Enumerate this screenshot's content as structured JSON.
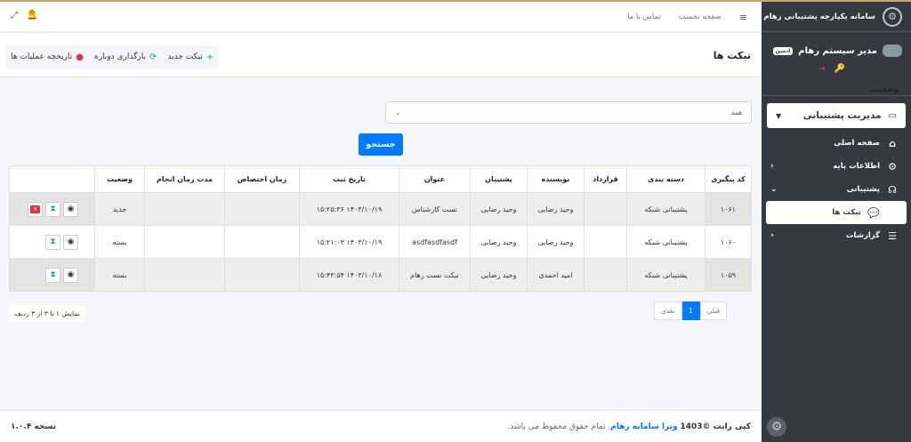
{
  "brand": {
    "title": "سامانه یکپارچه پشتیبانی رهام"
  },
  "user": {
    "name": "مدیر سیستم رهام",
    "badge": "ادمین"
  },
  "sidebar": {
    "section": "مدیریت پشتیبانی",
    "items": [
      {
        "label": "صفحه اصلی",
        "icon": "home-icon"
      },
      {
        "label": "اطلاعات پایه",
        "icon": "gears-icon"
      },
      {
        "label": "پشتیبانی",
        "icon": "headset-icon"
      },
      {
        "label": "تیکت ها",
        "icon": "comments-icon"
      },
      {
        "label": "گزارشات",
        "icon": "list-icon"
      }
    ]
  },
  "topnav": {
    "home": "صفحه نخست",
    "contact": "تماس با ما",
    "notif_count": "0"
  },
  "header": {
    "title": "تیکت ها",
    "new_ticket": "تیکت جدید",
    "reload": "بارگذاری دوباره",
    "history": "تاریخچه عملیات ها"
  },
  "filter": {
    "label": "وضعیت",
    "selected": "همه",
    "search": "جستجو"
  },
  "table": {
    "headers": [
      "کد پیگیری",
      "دسته بندی",
      "قرارداد",
      "نویسنده",
      "پشتیبان",
      "عنوان",
      "تاریخ ثبت",
      "زمان اختصاص",
      "مدت زمان انجام",
      "وضعیت",
      ""
    ],
    "rows": [
      {
        "code": "۱۰۶۱",
        "category": "پشتیبانی شبکه",
        "contract": "",
        "author": "وحید رضایی",
        "support": "وحید رضایی",
        "title": "تست کارشناس",
        "date": "۱۴۰۳/۱۰/۱۹ ۱۵:۲۵:۳۶",
        "assign": "",
        "duration": "",
        "status": "جدید"
      },
      {
        "code": "۱۰۶۰",
        "category": "پشتیبانی شبکه",
        "contract": "",
        "author": "وحید رضایی",
        "support": "وحید رضایی",
        "title": "asdfasdfasdf",
        "date": "۱۴۰۳/۱۰/۱۹ ۱۵:۲۱:۰۳",
        "assign": "",
        "duration": "",
        "status": "بسته"
      },
      {
        "code": "۱۰۵۹",
        "category": "پشتیبانی شبکه",
        "contract": "",
        "author": "امید احمدی",
        "support": "وحید رضایی",
        "title": "تیکت تست رهام",
        "date": "۱۴۰۳/۱۰/۱۸ ۱۵:۴۳:۵۴",
        "assign": "",
        "duration": "",
        "status": "بسته"
      }
    ]
  },
  "info": "نمایش ۱ تا ۳ از ۳ ردیف",
  "pager": {
    "prev": "قبلی",
    "page": "1",
    "next": "بعدی"
  },
  "footer": {
    "copy": "کپی رایت ©1403",
    "brand": "ویرا سامانه رهام",
    "rights": ". تمام حقوق محفوظ می باشد.",
    "version": "نسخه ۱.۰.۴"
  },
  "colors": {
    "primary": "#007bff",
    "sidebar": "#343a40",
    "danger": "#dc3545",
    "info": "#17a2b8",
    "success": "#28a745"
  }
}
